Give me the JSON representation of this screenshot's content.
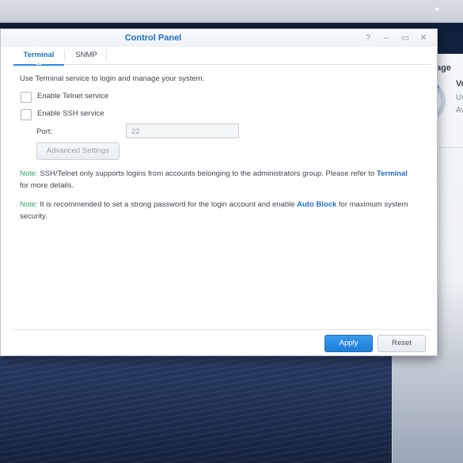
{
  "window": {
    "title": "Control Panel",
    "controls": {
      "help_icon": "?",
      "minimize_icon": "–",
      "maximize_icon": "▭",
      "close_icon": "✕"
    }
  },
  "tabs": [
    {
      "label": "Terminal",
      "active": true
    },
    {
      "label": "SNMP",
      "active": false
    }
  ],
  "terminal": {
    "intro": "Use Terminal service to login and manage your system.",
    "telnet_label": "Enable Telnet service",
    "telnet_checked": false,
    "ssh_label": "Enable SSH service",
    "ssh_checked": false,
    "port_label": "Port:",
    "port_value": "22",
    "advanced_button": "Advanced Settings"
  },
  "notes": [
    {
      "tag": "Note:",
      "text_before": " SSH/Telnet only supports logins from accounts belonging to the administrators group. Please refer to ",
      "link": "Terminal",
      "text_after": " for more details."
    },
    {
      "tag": "Note:",
      "text_before": " It is recommended to set a strong password for the login account and enable ",
      "link": "Auto Block",
      "text_after": " for maximum system security."
    }
  ],
  "footer": {
    "apply": "Apply",
    "reset": "Reset"
  },
  "background_widget": {
    "title_fragment": "age",
    "line1": "Vo",
    "line2": "Us",
    "line3": "Av"
  },
  "colors": {
    "accent": "#1e6fc2",
    "note_green": "#2fa86c",
    "apply_blue": "#2b8ae0"
  }
}
